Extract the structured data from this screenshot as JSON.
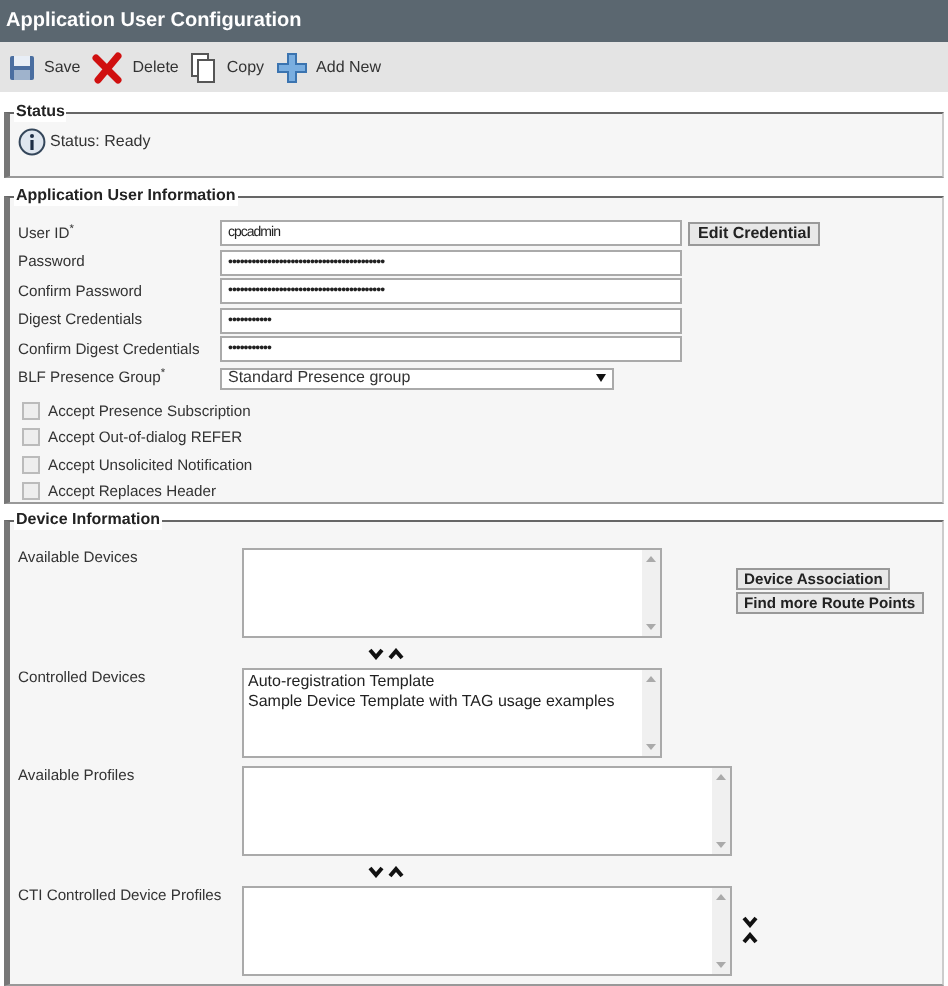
{
  "window": {
    "title": "Application User Configuration"
  },
  "toolbar": [
    {
      "label": "Save",
      "kind": "save"
    },
    {
      "label": "Delete",
      "kind": "delete"
    },
    {
      "label": "Copy",
      "kind": "copy"
    },
    {
      "label": "Add New",
      "kind": "add"
    }
  ],
  "status": {
    "legend": "Status",
    "message": "Status: Ready"
  },
  "user_info": {
    "legend": "Application User Information",
    "fields": [
      {
        "label": "User ID$^{*}$",
        "kind": "text",
        "value": "cpcadmin"
      },
      {
        "label": "Password",
        "kind": "text",
        "value": "••••••••••••••••••••••••••••••••••••••••"
      },
      {
        "label": "Confirm Password",
        "kind": "text",
        "value": "••••••••••••••••••••••••••••••••••••••••"
      },
      {
        "label": "Digest Credentials",
        "kind": "text",
        "value": "•••••••••••"
      },
      {
        "label": "Confirm Digest Credentials",
        "kind": "text",
        "value": "•••••••••••"
      },
      {
        "label": "BLF Presence Group$^{*}$",
        "kind": "select",
        "value": "Standard Presence group"
      }
    ],
    "edit_button": "Edit Credential",
    "checkboxes": [
      {
        "label": "Accept Presence Subscription",
        "checked": false
      },
      {
        "label": "Accept Out-of-dialog REFER",
        "checked": false
      },
      {
        "label": "Accept Unsolicited Notification",
        "checked": false
      },
      {
        "label": "Accept Replaces Header",
        "checked": false
      }
    ]
  },
  "device_info": {
    "legend": "Device Information",
    "buttons": [
      "Device Association",
      "Find more Route Points"
    ],
    "lists": [
      {
        "label": "Available Devices",
        "kind": "narrow"
      },
      {
        "label": "Controlled Devices",
        "kind": "narrow",
        "items": [
          "Auto-registration Template",
          "Sample Device Template with TAG usage examples"
        ]
      },
      {
        "label": "Available Profiles",
        "kind": "wide"
      },
      {
        "label": "CTI Controlled Device Profiles",
        "kind": "wide"
      }
    ]
  }
}
